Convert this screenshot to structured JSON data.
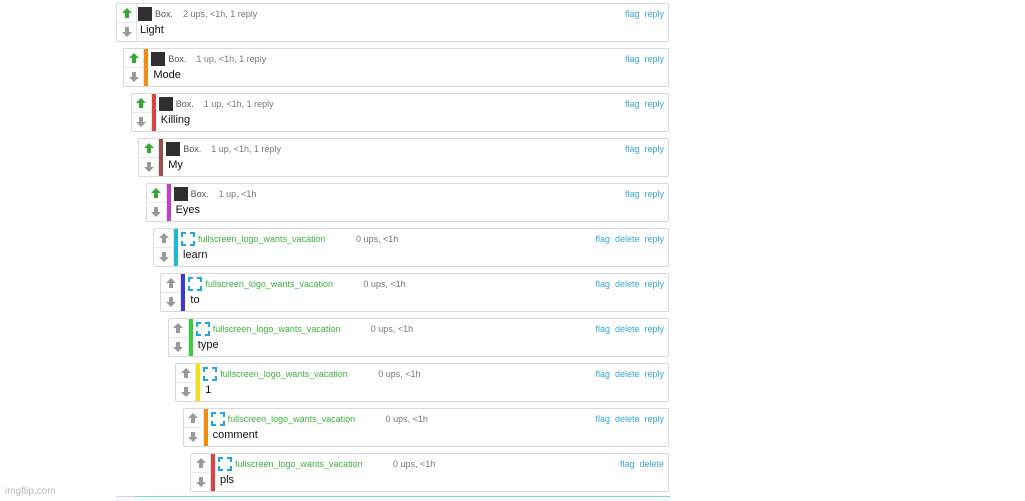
{
  "comments": [
    {
      "user": "Box.",
      "meta": "2 ups, <1h, 1 reply",
      "text": "Light",
      "voted": true,
      "stripe": null,
      "avatar": "dark",
      "actions": [
        "flag",
        "reply"
      ]
    },
    {
      "user": "Box.",
      "meta": "1 up, <1h, 1 reply",
      "text": "Mode",
      "voted": true,
      "stripe": "#f28c0f",
      "avatar": "dark",
      "actions": [
        "flag",
        "reply"
      ]
    },
    {
      "user": "Box.",
      "meta": "1 up, <1h, 1 reply",
      "text": "Killing",
      "voted": true,
      "stripe": "#e04040",
      "avatar": "dark",
      "actions": [
        "flag",
        "reply"
      ]
    },
    {
      "user": "Box.",
      "meta": "1 up, <1h, 1 reply",
      "text": "My",
      "voted": true,
      "stripe": "#9b5050",
      "avatar": "dark",
      "actions": [
        "flag",
        "reply"
      ]
    },
    {
      "user": "Box.",
      "meta": "1 up, <1h",
      "text": "Eyes",
      "voted": true,
      "stripe": "#c040c8",
      "avatar": "dark",
      "actions": [
        "flag",
        "reply"
      ]
    },
    {
      "user": "fullscreen_logo_wants_vacation",
      "meta": "0 ups, <1h",
      "text": "learn",
      "voted": false,
      "stripe": "#1fb8d8",
      "avatar": "fullscreen",
      "actions": [
        "flag",
        "delete",
        "reply"
      ]
    },
    {
      "user": "fullscreen_logo_wants_vacation",
      "meta": "0 ups, <1h",
      "text": "to",
      "voted": false,
      "stripe": "#3a3ad8",
      "avatar": "fullscreen",
      "actions": [
        "flag",
        "delete",
        "reply"
      ]
    },
    {
      "user": "fullscreen_logo_wants_vacation",
      "meta": "0 ups, <1h",
      "text": "type",
      "voted": false,
      "stripe": "#3ccc3c",
      "avatar": "fullscreen",
      "actions": [
        "flag",
        "delete",
        "reply"
      ]
    },
    {
      "user": "fullscreen_logo_wants_vacation",
      "meta": "0 ups, <1h",
      "text": "1",
      "voted": false,
      "stripe": "#f2e010",
      "avatar": "fullscreen",
      "actions": [
        "flag",
        "delete",
        "reply"
      ]
    },
    {
      "user": "fullscreen_logo_wants_vacation",
      "meta": "0 ups, <1h",
      "text": "comment",
      "voted": false,
      "stripe": "#f28c0f",
      "avatar": "fullscreen",
      "actions": [
        "flag",
        "delete",
        "reply"
      ]
    },
    {
      "user": "fullscreen_logo_wants_vacation",
      "meta": "0 ups, <1h",
      "text": "pls",
      "voted": false,
      "stripe": "#e04040",
      "avatar": "fullscreen",
      "actions": [
        "flag",
        "delete"
      ]
    }
  ],
  "colors": {
    "upvoted": "#33aa33",
    "novote": "#9a9a9a",
    "username_box": "#555555",
    "username_fullscreen": "#3db23d",
    "link": "#37a8d6",
    "fullscreen_icon": "#1ea7e8"
  },
  "watermark": "imgflip.com"
}
